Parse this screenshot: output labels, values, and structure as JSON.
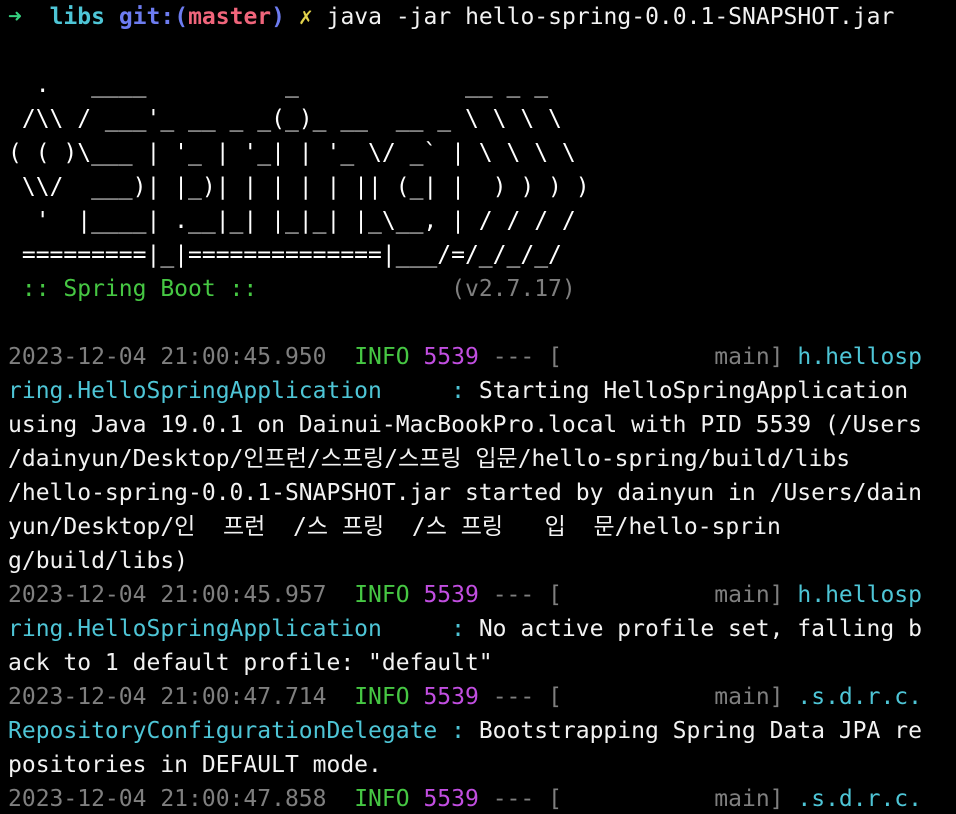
{
  "prompt": {
    "arrow": "➜",
    "dir": "libs",
    "git_label": "git:(",
    "branch": "master",
    "git_close": ")",
    "dirty_mark": "✗",
    "command": "java -jar hello-spring-0.0.1-SNAPSHOT.jar"
  },
  "banner": {
    "lines": [
      "  .   ____          _            __ _ _",
      " /\\\\ / ___'_ __ _ _(_)_ __  __ _ \\ \\ \\ \\",
      "( ( )\\___ | '_ | '_| | '_ \\/ _` | \\ \\ \\ \\",
      " \\\\/  ___)| |_)| | | | | || (_| |  ) ) ) )",
      "  '  |____| .__|_| |_|_| |_\\__, | / / / /",
      " =========|_|==============|___/=/_/_/_/"
    ],
    "boot_label": " :: Spring Boot :: ",
    "version": "(v2.7.17)"
  },
  "colors": {
    "background": "#000000",
    "prompt_arrow": "#35d07f",
    "dir": "#4ec5d6",
    "branch": "#f0657b",
    "info": "#46c743",
    "pid": "#c14ee0",
    "logger": "#4ec5d6",
    "muted": "#7f7f7f"
  },
  "log": [
    {
      "ts": "2023-12-04 21:00:45.950",
      "level": "INFO",
      "pid": "5539",
      "sep": "--- [",
      "thread": "           main]",
      "logger_l1": "h.hellosp",
      "logger_l2": "ring.HelloSpringApplication",
      "colon": "     : ",
      "msg_first": "Starting HelloSpringApplication",
      "msg_rest": [
        "using Java 19.0.1 on Dainui-MacBookPro.local with PID 5539 (/Users",
        "/dainyun/Desktop/인프런/스프링/스프링 입문/hello-spring/build/libs",
        "/hello-spring-0.0.1-SNAPSHOT.jar started by dainyun in /Users/dain",
        "yun/Desktop/인  프런  /스 프링  /스 프링   입  문/hello-sprin",
        "g/build/libs)"
      ]
    },
    {
      "ts": "2023-12-04 21:00:45.957",
      "level": "INFO",
      "pid": "5539",
      "sep": "--- [",
      "thread": "           main]",
      "logger_l1": "h.hellosp",
      "logger_l2": "ring.HelloSpringApplication",
      "colon": "     : ",
      "msg_first": "No active profile set, falling b",
      "msg_rest": [
        "ack to 1 default profile: \"default\""
      ]
    },
    {
      "ts": "2023-12-04 21:00:47.714",
      "level": "INFO",
      "pid": "5539",
      "sep": "--- [",
      "thread": "           main]",
      "logger_l1": ".s.d.r.c.",
      "logger_l2": "RepositoryConfigurationDelegate",
      "colon": " : ",
      "msg_first": "Bootstrapping Spring Data JPA re",
      "msg_rest": [
        "positories in DEFAULT mode."
      ]
    },
    {
      "ts": "2023-12-04 21:00:47.858",
      "level": "INFO",
      "pid": "5539",
      "sep": "--- [",
      "thread": "           main]",
      "logger_l1": ".s.d.r.c."
    }
  ]
}
